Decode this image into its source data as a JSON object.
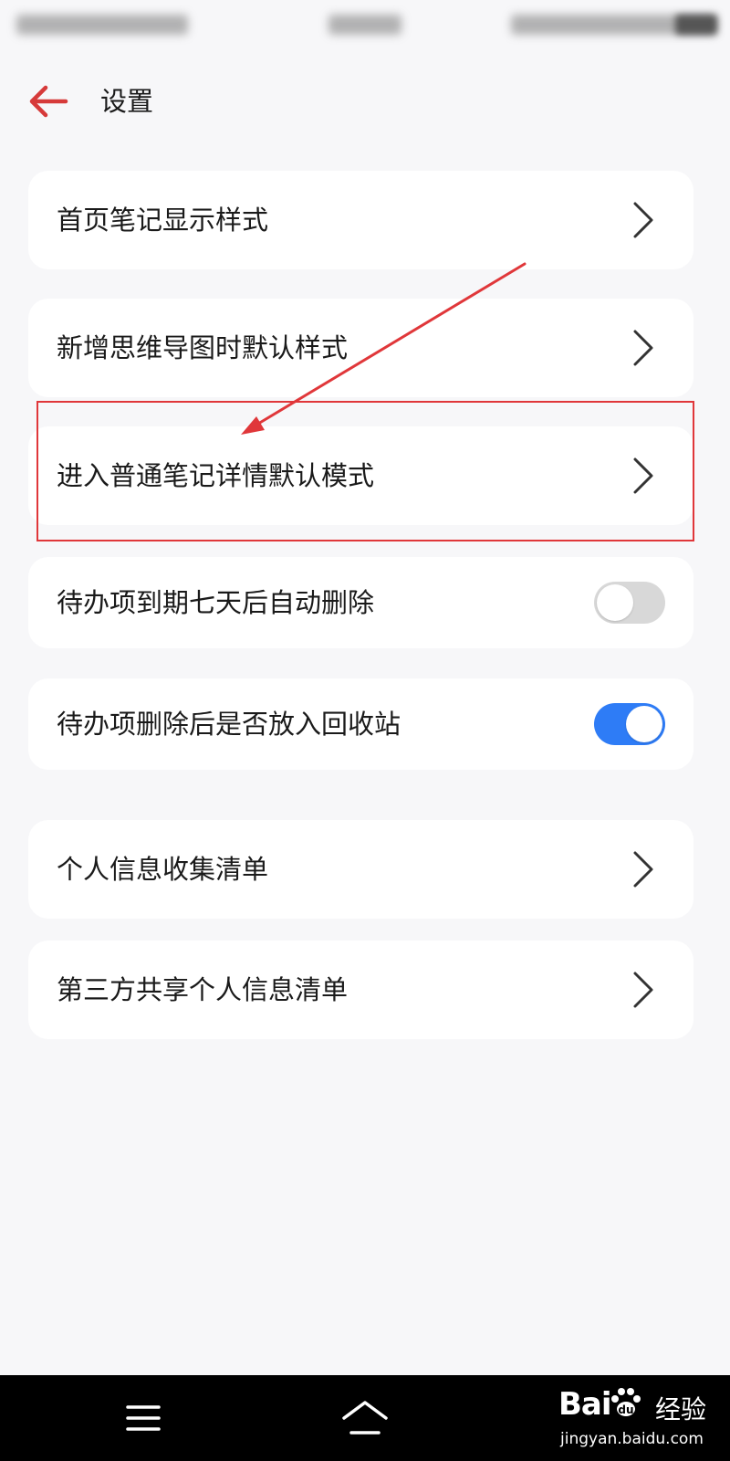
{
  "colors": {
    "accent_red": "#d63a3a",
    "toggle_on": "#2e7cf6",
    "toggle_off": "#d8d8d8",
    "background": "#f7f7f9",
    "card": "#ffffff",
    "annotation": "#e0373a"
  },
  "header": {
    "title": "设置",
    "back_icon": "arrow-left-icon"
  },
  "settings": {
    "home_note_style": {
      "label": "首页笔记显示样式",
      "icon": "chevron-right-icon"
    },
    "mindmap_default_style": {
      "label": "新增思维导图时默认样式",
      "icon": "chevron-right-icon"
    },
    "note_detail_default_mode": {
      "label": "进入普通笔记详情默认模式",
      "icon": "chevron-right-icon"
    },
    "todo_auto_delete": {
      "label": "待办项到期七天后自动删除",
      "toggle": "off"
    },
    "todo_recycle_bin": {
      "label": "待办项删除后是否放入回收站",
      "toggle": "on"
    },
    "personal_info_list": {
      "label": "个人信息收集清单",
      "icon": "chevron-right-icon"
    },
    "third_party_share_list": {
      "label": "第三方共享个人信息清单",
      "icon": "chevron-right-icon"
    }
  },
  "nav_bar": {
    "menu_icon": "menu-icon",
    "home_icon": "home-icon"
  },
  "watermark": {
    "logo_left": "Bai",
    "logo_right": "经验",
    "url": "jingyan.baidu.com"
  }
}
